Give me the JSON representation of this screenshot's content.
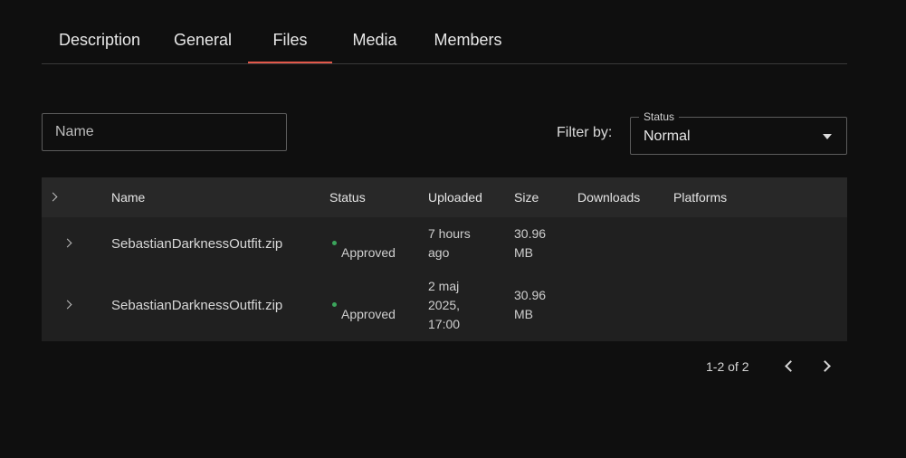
{
  "tabs": [
    {
      "label": "Description"
    },
    {
      "label": "General"
    },
    {
      "label": "Files",
      "active": true
    },
    {
      "label": "Media"
    },
    {
      "label": "Members"
    }
  ],
  "search": {
    "placeholder": "Name",
    "value": ""
  },
  "filter": {
    "label": "Filter by:",
    "legend": "Status",
    "value": "Normal"
  },
  "table": {
    "headers": {
      "name": "Name",
      "status": "Status",
      "uploaded": "Uploaded",
      "size": "Size",
      "downloads": "Downloads",
      "platforms": "Platforms"
    },
    "rows": [
      {
        "name": "SebastianDarknessOutfit.zip",
        "status": "Approved",
        "uploaded_lines": [
          "7 hours",
          "ago"
        ],
        "size_lines": [
          "30.96",
          "MB"
        ],
        "downloads": "",
        "platforms": ""
      },
      {
        "name": "SebastianDarknessOutfit.zip",
        "status": "Approved",
        "uploaded_lines": [
          "2 maj",
          "2025,",
          "17:00"
        ],
        "size_lines": [
          "30.96",
          "MB"
        ],
        "downloads": "",
        "platforms": ""
      }
    ]
  },
  "pagination": {
    "text": "1-2 of 2"
  },
  "colors": {
    "background": "#0f0f0f",
    "table_row": "#202020",
    "table_header": "#282828",
    "accent": "#e2584a",
    "status_ok": "#3ba55c"
  },
  "icons": {
    "expand": "chevron-right-icon",
    "select": "caret-down-icon",
    "prev": "chevron-left-icon",
    "next": "chevron-right-icon"
  }
}
